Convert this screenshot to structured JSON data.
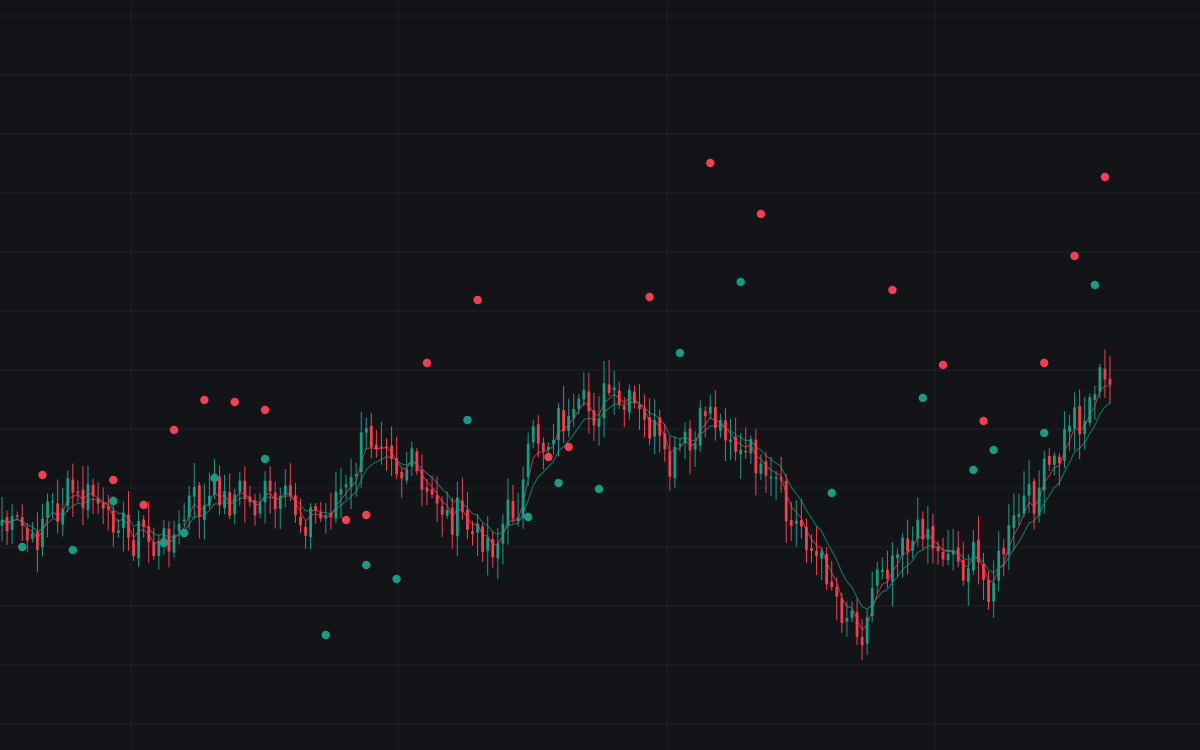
{
  "colors": {
    "background": "#131418",
    "grid": "#1f2127",
    "up": "#1a9b86",
    "down": "#f23f53",
    "pivot_high": "#f23f53",
    "pivot_low": "#1a9b86"
  },
  "chart_data": {
    "type": "candlestick",
    "title": "",
    "xlabel": "",
    "ylabel": "",
    "grid": true,
    "price_range": [
      0,
      750
    ],
    "candle_count": 220,
    "ohlc_path": {
      "description_free": true,
      "anchors": [
        [
          0,
          520
        ],
        [
          6,
          540
        ],
        [
          10,
          505
        ],
        [
          16,
          495
        ],
        [
          22,
          520
        ],
        [
          26,
          535
        ],
        [
          32,
          545
        ],
        [
          38,
          505
        ],
        [
          44,
          495
        ],
        [
          50,
          500
        ],
        [
          56,
          505
        ],
        [
          62,
          520
        ],
        [
          66,
          500
        ],
        [
          74,
          430
        ],
        [
          80,
          470
        ],
        [
          86,
          505
        ],
        [
          92,
          525
        ],
        [
          96,
          545
        ],
        [
          100,
          520
        ],
        [
          106,
          440
        ],
        [
          112,
          420
        ],
        [
          120,
          400
        ],
        [
          126,
          415
        ],
        [
          132,
          465
        ],
        [
          136,
          445
        ],
        [
          140,
          410
        ],
        [
          146,
          450
        ],
        [
          152,
          485
        ],
        [
          156,
          520
        ],
        [
          160,
          545
        ],
        [
          164,
          585
        ],
        [
          168,
          620
        ],
        [
          170,
          625
        ],
        [
          174,
          560
        ],
        [
          178,
          540
        ],
        [
          182,
          530
        ],
        [
          186,
          550
        ],
        [
          190,
          560
        ],
        [
          196,
          580
        ],
        [
          200,
          520
        ],
        [
          206,
          480
        ],
        [
          212,
          420
        ],
        [
          218,
          380
        ]
      ]
    },
    "pivots_high": [
      {
        "i": 8,
        "price": 475
      },
      {
        "i": 22,
        "price": 480
      },
      {
        "i": 28,
        "price": 505
      },
      {
        "i": 34,
        "price": 430
      },
      {
        "i": 40,
        "price": 400
      },
      {
        "i": 46,
        "price": 402
      },
      {
        "i": 52,
        "price": 410
      },
      {
        "i": 68,
        "price": 520
      },
      {
        "i": 72,
        "price": 515
      },
      {
        "i": 84,
        "price": 363
      },
      {
        "i": 94,
        "price": 300
      },
      {
        "i": 108,
        "price": 457
      },
      {
        "i": 112,
        "price": 447
      },
      {
        "i": 128,
        "price": 297
      },
      {
        "i": 140,
        "price": 163
      },
      {
        "i": 150,
        "price": 214
      },
      {
        "i": 176,
        "price": 290
      },
      {
        "i": 186,
        "price": 365
      },
      {
        "i": 194,
        "price": 421
      },
      {
        "i": 206,
        "price": 363
      },
      {
        "i": 212,
        "price": 256
      },
      {
        "i": 218,
        "price": 177
      }
    ],
    "pivots_low": [
      {
        "i": 4,
        "price": 547
      },
      {
        "i": 14,
        "price": 550
      },
      {
        "i": 22,
        "price": 501
      },
      {
        "i": 32,
        "price": 543
      },
      {
        "i": 36,
        "price": 533
      },
      {
        "i": 42,
        "price": 478
      },
      {
        "i": 52,
        "price": 459
      },
      {
        "i": 64,
        "price": 635
      },
      {
        "i": 72,
        "price": 565
      },
      {
        "i": 78,
        "price": 579
      },
      {
        "i": 92,
        "price": 420
      },
      {
        "i": 104,
        "price": 517
      },
      {
        "i": 110,
        "price": 483
      },
      {
        "i": 118,
        "price": 489
      },
      {
        "i": 134,
        "price": 353
      },
      {
        "i": 146,
        "price": 282
      },
      {
        "i": 164,
        "price": 493
      },
      {
        "i": 182,
        "price": 398
      },
      {
        "i": 192,
        "price": 470
      },
      {
        "i": 196,
        "price": 450
      },
      {
        "i": 206,
        "price": 433
      },
      {
        "i": 216,
        "price": 285
      }
    ]
  }
}
